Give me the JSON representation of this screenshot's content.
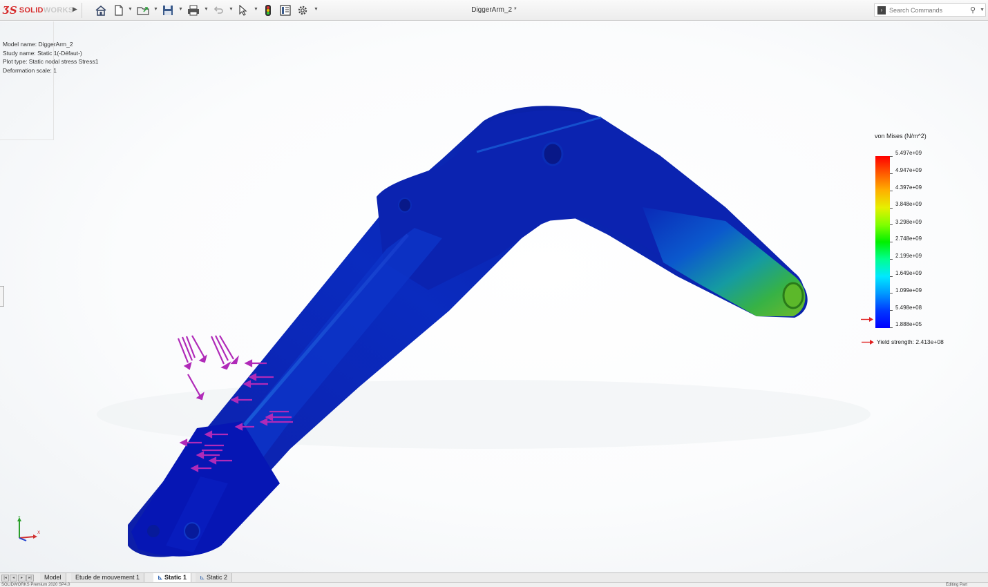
{
  "app": {
    "logo_mark": "ƷS",
    "logo_text_a": "SOLID",
    "logo_text_b": "WORKS",
    "document_title": "DiggerArm_2 *"
  },
  "toolbar": {
    "icons": [
      "home-icon",
      "new-document-icon",
      "open-icon",
      "save-icon",
      "print-icon",
      "undo-icon",
      "select-icon",
      "traffic-light-icon",
      "file-properties-icon",
      "options-gear-icon"
    ]
  },
  "search": {
    "placeholder": "Search Commands"
  },
  "study_info": {
    "model_name": "Model name: DiggerArm_2",
    "study_name": "Study name: Static 1(-Défaut-)",
    "plot_type": "Plot type: Static nodal stress Stress1",
    "deformation_scale": "Deformation scale: 1"
  },
  "legend": {
    "title": "von Mises (N/m^2)",
    "ticks": [
      "5.497e+09",
      "4.947e+09",
      "4.397e+09",
      "3.848e+09",
      "3.298e+09",
      "2.748e+09",
      "2.199e+09",
      "1.649e+09",
      "1.099e+09",
      "5.498e+08",
      "1.888e+05"
    ],
    "yield_label": "Yield strength: 2.413e+08",
    "colors": {
      "max": "#ff0000",
      "mid": "#00f000",
      "min": "#0000ff",
      "yield_marker": "#e02020"
    }
  },
  "triad": {
    "y_label": "Y",
    "x_label": "X"
  },
  "tabs": [
    {
      "label": "Model",
      "active": false
    },
    {
      "label": "Etude de mouvement 1",
      "active": false
    },
    {
      "label": "Static 1",
      "active": true
    },
    {
      "label": "Static 2",
      "active": false
    }
  ],
  "statusbar": {
    "left": "SOLIDWORKS Premium 2020 SP4.0",
    "right": "Editing Part"
  }
}
